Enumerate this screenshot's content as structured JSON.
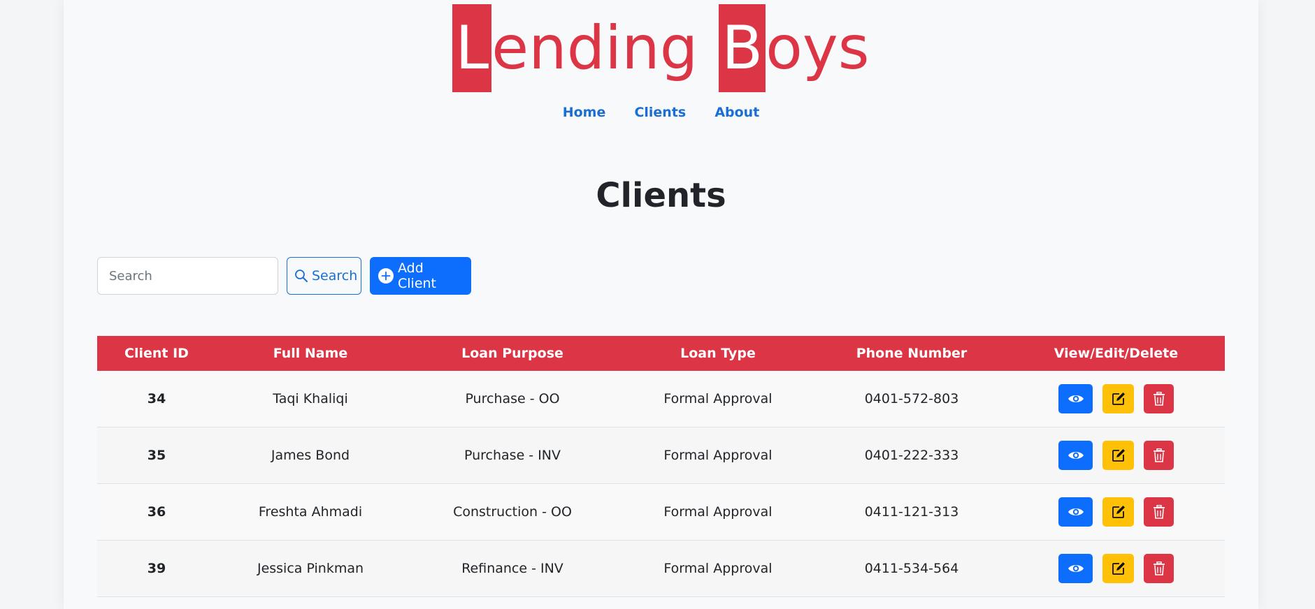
{
  "logo": {
    "first_letter": "L",
    "first_rest": "ending",
    "second_letter": "B",
    "second_rest": "oys",
    "color": "#dc3545"
  },
  "nav": [
    {
      "label": "Home"
    },
    {
      "label": "Clients"
    },
    {
      "label": "About"
    }
  ],
  "page_title": "Clients",
  "search": {
    "placeholder": "Search",
    "value": "",
    "button_label": "Search",
    "button_icon": "search-icon"
  },
  "add_client": {
    "label": "Add Client",
    "icon": "plus-circle-icon"
  },
  "table": {
    "headers": [
      "Client ID",
      "Full Name",
      "Loan Purpose",
      "Loan Type",
      "Phone Number",
      "View/Edit/Delete"
    ],
    "header_color": "#dc3545",
    "rows": [
      {
        "id": "34",
        "name": "Taqi Khaliqi",
        "purpose": "Purchase - OO",
        "type": "Formal Approval",
        "phone": "0401-572-803"
      },
      {
        "id": "35",
        "name": "James Bond",
        "purpose": "Purchase - INV",
        "type": "Formal Approval",
        "phone": "0401-222-333"
      },
      {
        "id": "36",
        "name": "Freshta Ahmadi",
        "purpose": "Construction - OO",
        "type": "Formal Approval",
        "phone": "0411-121-313"
      },
      {
        "id": "39",
        "name": "Jessica Pinkman",
        "purpose": "Refinance - INV",
        "type": "Formal Approval",
        "phone": "0411-534-564"
      }
    ],
    "action_icons": [
      "eye-icon",
      "edit-icon",
      "trash-icon"
    ],
    "action_colors": {
      "view": "#0d6efd",
      "edit": "#ffc107",
      "delete": "#dc3545"
    }
  },
  "colors": {
    "accent_red": "#dc3545",
    "primary_blue": "#0d6efd",
    "link_blue": "#1a6fd6",
    "warning_yellow": "#ffc107"
  }
}
